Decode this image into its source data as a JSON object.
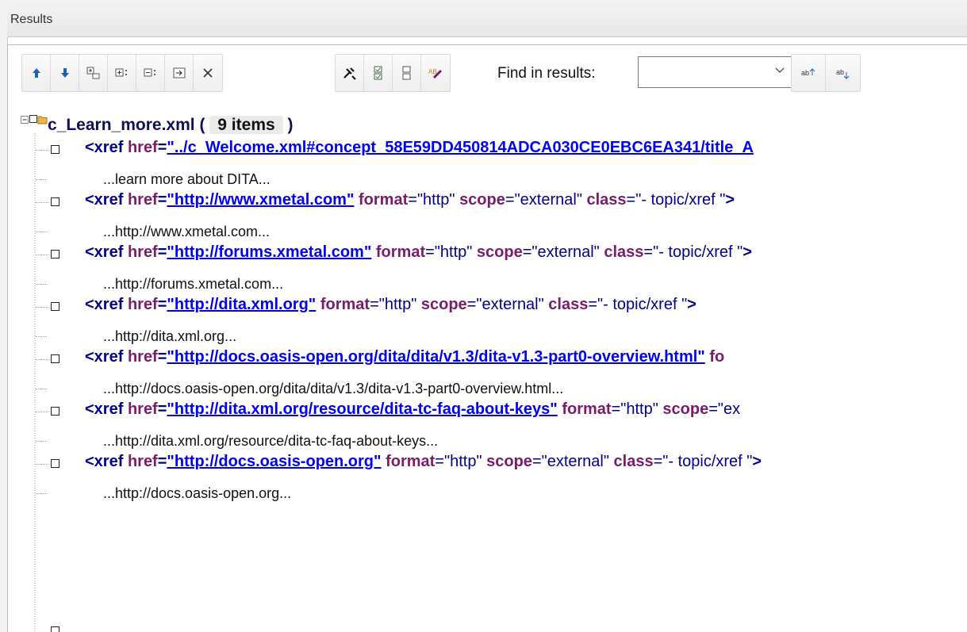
{
  "panel": {
    "title": "Results"
  },
  "toolbar": {
    "buttons_left": [
      "up-arrow-icon",
      "down-arrow-icon",
      "expand-icon",
      "expand-all-icon",
      "collapse-all-icon",
      "go-to-icon",
      "close-icon"
    ],
    "buttons_right": [
      "tools-icon",
      "check-all-icon",
      "uncheck-all-icon",
      "mark-icon"
    ],
    "find_label": "Find in results:",
    "find_value": "",
    "search_buttons": [
      "find-previous-icon",
      "find-next-icon"
    ]
  },
  "tree": {
    "root": {
      "name": "c_Learn_more.xml",
      "open": "(",
      "count": "9 items",
      "close": ")"
    },
    "items": [
      {
        "tag": "<xref ",
        "href_attr": "href",
        "href": "\"../c_Welcome.xml#concept_58E59DD450814ADCA030CE0EBC6EA341/title_A",
        "rest": [],
        "context": "...learn more about DITA..."
      },
      {
        "tag": "<xref ",
        "href_attr": "href",
        "href": "\"http://www.xmetal.com\"",
        "rest": [
          [
            "format",
            "\"http\""
          ],
          [
            "scope",
            "\"external\""
          ],
          [
            "class",
            "\"- topic/xref \""
          ]
        ],
        "end": ">",
        "context": "...http://www.xmetal.com..."
      },
      {
        "tag": "<xref ",
        "href_attr": "href",
        "href": "\"http://forums.xmetal.com\"",
        "rest": [
          [
            "format",
            "\"http\""
          ],
          [
            "scope",
            "\"external\""
          ],
          [
            "class",
            "\"- topic/xref \""
          ]
        ],
        "end": ">",
        "context": "...http://forums.xmetal.com..."
      },
      {
        "tag": "<xref ",
        "href_attr": "href",
        "href": "\"http://dita.xml.org\"",
        "rest": [
          [
            "format",
            "\"http\""
          ],
          [
            "scope",
            "\"external\""
          ],
          [
            "class",
            "\"- topic/xref \""
          ]
        ],
        "end": ">",
        "context": "...http://dita.xml.org..."
      },
      {
        "tag": "<xref ",
        "href_attr": "href",
        "href": "\"http://docs.oasis-open.org/dita/dita/v1.3/dita-v1.3-part0-overview.html\"",
        "rest": [
          [
            "fo",
            ""
          ]
        ],
        "end": "",
        "context": "...http://docs.oasis-open.org/dita/dita/v1.3/dita-v1.3-part0-overview.html..."
      },
      {
        "tag": "<xref ",
        "href_attr": "href",
        "href": "\"http://dita.xml.org/resource/dita-tc-faq-about-keys\"",
        "rest": [
          [
            "format",
            "\"http\""
          ],
          [
            "scope",
            "\"ex"
          ]
        ],
        "end": "",
        "context": "...http://dita.xml.org/resource/dita-tc-faq-about-keys..."
      },
      {
        "tag": "<xref ",
        "href_attr": "href",
        "href": "\"http://docs.oasis-open.org\"",
        "rest": [
          [
            "format",
            "\"http\""
          ],
          [
            "scope",
            "\"external\""
          ],
          [
            "class",
            "\"- topic/xref \""
          ]
        ],
        "end": ">",
        "context": "...http://docs.oasis-open.org..."
      }
    ]
  },
  "colors": {
    "tag": "#00008b",
    "attr": "#7a1b6c",
    "link": "#0000ee"
  }
}
